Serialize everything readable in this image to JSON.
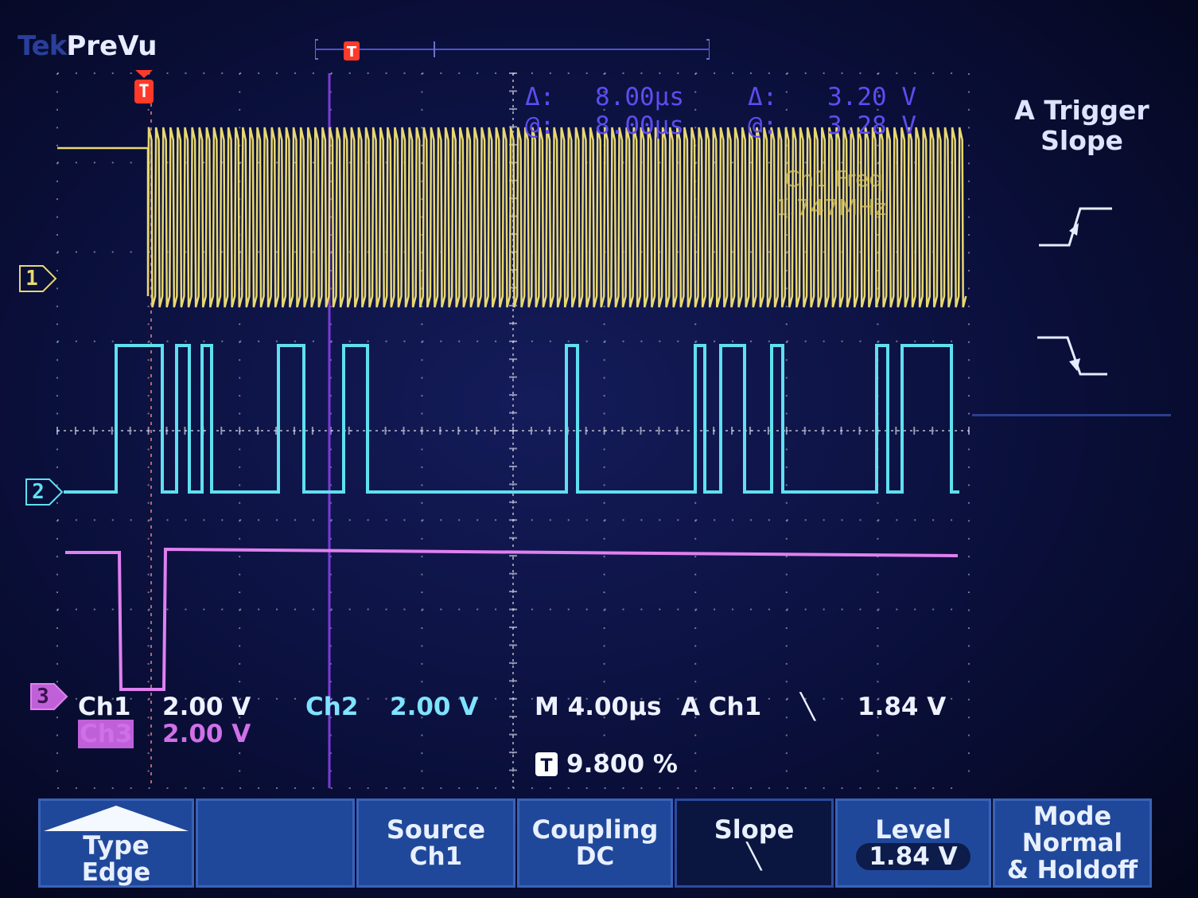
{
  "header": {
    "brand": "Tek",
    "mode": "PreVu"
  },
  "cursor_readout": {
    "delta_label": "Δ:",
    "at_label": "@:",
    "time_delta": "8.00µs",
    "time_at": "8.00µs",
    "volt_delta": "3.20 V",
    "volt_at": "3.28 V"
  },
  "measurement": {
    "label": "Ch1 Freq",
    "value": "1.747MHz"
  },
  "channel_markers": {
    "ch1": "1",
    "ch2": "2",
    "ch3": "3",
    "trigger": "T"
  },
  "readouts": {
    "ch1": {
      "name": "Ch1",
      "scale": "2.00 V"
    },
    "ch2": {
      "name": "Ch2",
      "scale": "2.00 V"
    },
    "ch3": {
      "name": "Ch3",
      "scale": "2.00 V"
    },
    "timebase": "M 4.00µs",
    "trigger_source": "A  Ch1",
    "trigger_slope_symbol": "╲",
    "trigger_level": "1.84 V",
    "trigger_position": "9.800 %"
  },
  "side_menu": {
    "title_line1": "A Trigger",
    "title_line2": "Slope",
    "options": [
      {
        "name": "rising",
        "selected": false
      },
      {
        "name": "falling",
        "selected": true
      }
    ]
  },
  "bottom_menu": [
    {
      "id": "type",
      "label": "Type",
      "value": "Edge"
    },
    {
      "id": "blank",
      "label": "",
      "value": ""
    },
    {
      "id": "source",
      "label": "Source",
      "value": "Ch1"
    },
    {
      "id": "coupling",
      "label": "Coupling",
      "value": "DC"
    },
    {
      "id": "slope",
      "label": "Slope",
      "value": "╲"
    },
    {
      "id": "level",
      "label": "Level",
      "value": "1.84 V"
    },
    {
      "id": "mode",
      "label": "Mode",
      "value": "Normal",
      "value2": "& Holdoff"
    }
  ],
  "colors": {
    "ch1": "#e8d870",
    "ch2": "#5fe0f0",
    "ch3": "#e080f0",
    "trigger": "#ff3a2a",
    "cursor": "#8a40e8",
    "grid": "#c8c8d8"
  },
  "chart_data": {
    "type": "line",
    "series": [
      {
        "name": "Ch1",
        "color": "#e8d870"
      },
      {
        "name": "Ch2",
        "color": "#5fe0f0"
      },
      {
        "name": "Ch3",
        "color": "#e080f0"
      }
    ]
  }
}
